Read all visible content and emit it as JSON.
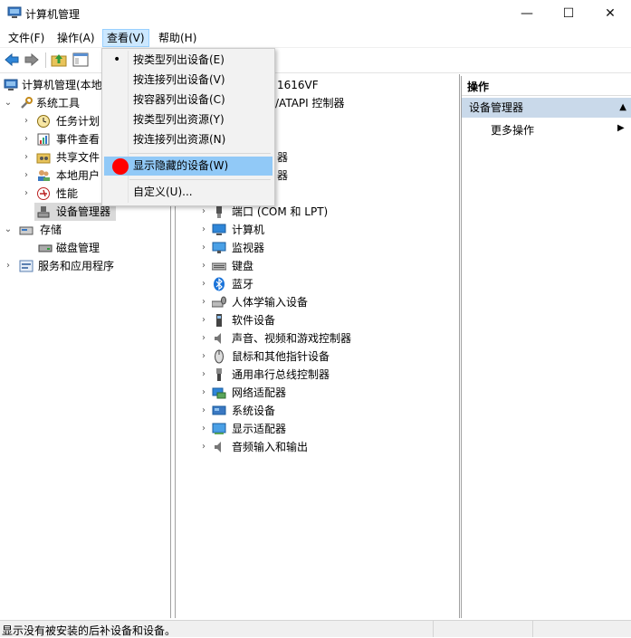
{
  "window": {
    "title": "计算机管理",
    "controls": {
      "minimize": "—",
      "maximize": "☐",
      "close": "✕"
    }
  },
  "menubar": {
    "items": [
      "文件(F)",
      "操作(A)",
      "查看(V)",
      "帮助(H)"
    ],
    "active_index": 2
  },
  "toolbar": {
    "icons": [
      "back-arrow-icon",
      "forward-arrow-icon",
      "folder-up-icon",
      "console-tree-icon"
    ]
  },
  "view_menu": {
    "items": [
      {
        "label": "按类型列出设备(E)",
        "checked": true
      },
      {
        "label": "按连接列出设备(V)",
        "checked": false
      },
      {
        "label": "按容器列出设备(C)",
        "checked": false
      },
      {
        "label": "按类型列出资源(Y)",
        "checked": false
      },
      {
        "label": "按连接列出资源(N)",
        "checked": false
      },
      {
        "label": "显示隐藏的设备(W)",
        "checked": false,
        "highlighted": true
      },
      {
        "label": "自定义(U)...",
        "checked": false
      }
    ],
    "marker_color": "#ff0000"
  },
  "left_tree": {
    "items": [
      {
        "label": "计算机管理(本地",
        "indent": 0,
        "expander": ""
      },
      {
        "label": "系统工具",
        "indent": 1,
        "expander": "expanded"
      },
      {
        "label": "任务计划",
        "indent": 2,
        "expander": "collapsed"
      },
      {
        "label": "事件查看",
        "indent": 2,
        "expander": "collapsed"
      },
      {
        "label": "共享文件",
        "indent": 2,
        "expander": "collapsed"
      },
      {
        "label": "本地用户",
        "indent": 2,
        "expander": "collapsed"
      },
      {
        "label": "性能",
        "indent": 2,
        "expander": "collapsed"
      },
      {
        "label": "设备管理器",
        "indent": 2,
        "expander": "",
        "selected": true
      },
      {
        "label": "存储",
        "indent": 1,
        "expander": "expanded"
      },
      {
        "label": "磁盘管理",
        "indent": 2,
        "expander": ""
      },
      {
        "label": "服务和应用程序",
        "indent": 1,
        "expander": "collapsed"
      }
    ]
  },
  "device_tree": {
    "partial_rows": [
      {
        "label": "1616VF"
      },
      {
        "label": "/ATAPI 控制器"
      },
      {
        "label": "器"
      },
      {
        "label": "器"
      }
    ],
    "items": [
      "端口 (COM 和 LPT)",
      "计算机",
      "监视器",
      "键盘",
      "蓝牙",
      "人体学输入设备",
      "软件设备",
      "声音、视频和游戏控制器",
      "鼠标和其他指针设备",
      "通用串行总线控制器",
      "网络适配器",
      "系统设备",
      "显示适配器",
      "音频输入和输出"
    ]
  },
  "actions_pane": {
    "header": "操作",
    "section": "设备管理器",
    "more": "更多操作"
  },
  "statusbar": {
    "text": "显示没有被安装的后补设备和设备。"
  }
}
